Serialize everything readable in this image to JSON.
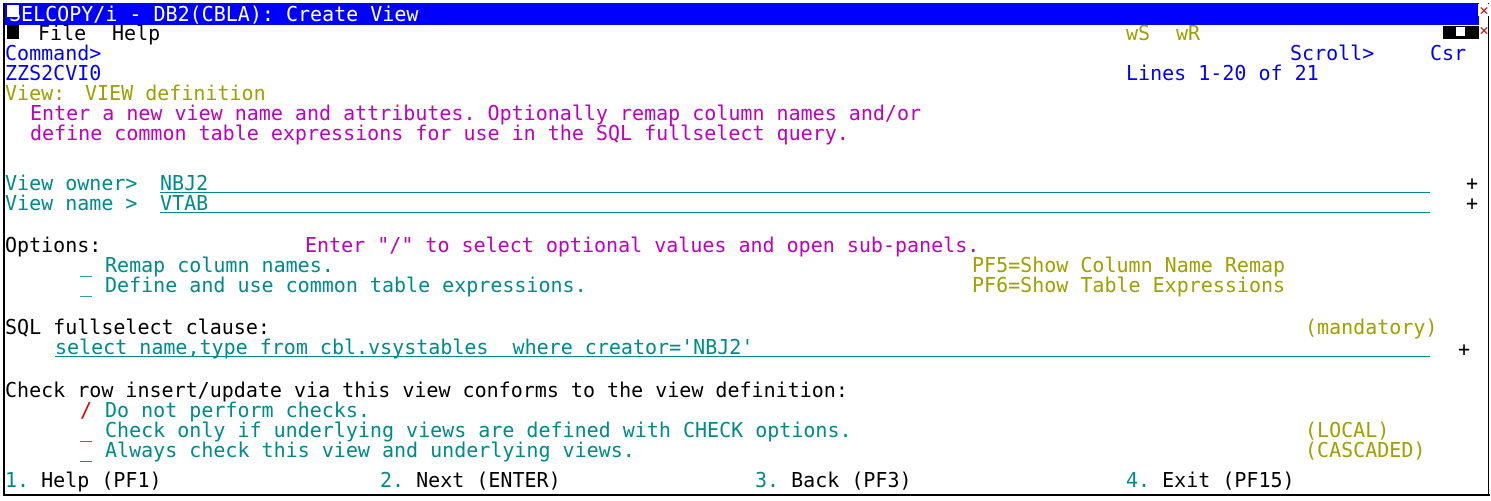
{
  "window": {
    "title": "SELCOPY/i - DB2(CBLA): Create View",
    "menu_file": "File",
    "menu_help": "Help",
    "ws": "wS",
    "wr": "wR"
  },
  "header": {
    "command_label": "Command>",
    "scroll_label": "Scroll>",
    "scroll_value": "Csr",
    "panel_id": "ZZS2CVI0",
    "lines_info": "Lines 1-20 of 21"
  },
  "section": {
    "view_label": "View:",
    "view_title": "VIEW definition",
    "instructions_1": "Enter a new view name and attributes. Optionally remap column names and/or",
    "instructions_2": "define common table expressions for use in the SQL fullselect query."
  },
  "fields": {
    "owner_label": "View owner>",
    "owner_value": "NBJ2",
    "name_label": "View name >",
    "name_value": "VTAB",
    "plus": "+"
  },
  "options": {
    "label": "Options:",
    "hint": "Enter \"/\" to select optional values and open sub-panels.",
    "items": [
      {
        "mark": "_",
        "label": "Remap column names.",
        "pf": "PF5=Show Column Name Remap"
      },
      {
        "mark": "_",
        "label": "Define and use common table expressions.",
        "pf": "PF6=Show Table Expressions"
      }
    ]
  },
  "sql": {
    "label": "SQL fullselect clause:",
    "mandatory": "(mandatory)",
    "value": "select name,type from cbl.vsystables  where creator='NBJ2'"
  },
  "check": {
    "heading": "Check row insert/update via this view conforms to the view definition:",
    "items": [
      {
        "mark": "/",
        "label": "Do not perform checks.",
        "tag": ""
      },
      {
        "mark": "_",
        "label": "Check only if underlying views are defined with CHECK options.",
        "tag": "(LOCAL)"
      },
      {
        "mark": "_",
        "label": "Always check this view and underlying views.",
        "tag": "(CASCADED)"
      }
    ]
  },
  "footer": {
    "actions": [
      {
        "num": "1.",
        "label": "Help (PF1)"
      },
      {
        "num": "2.",
        "label": "Next (ENTER)"
      },
      {
        "num": "3.",
        "label": "Back (PF3)"
      },
      {
        "num": "4.",
        "label": "Exit (PF15)"
      }
    ]
  },
  "colors": {
    "title_bg": "#0000ff",
    "field": "#008b8b",
    "olive": "#a0a000",
    "magenta": "#c000c0",
    "red": "#e00000"
  }
}
